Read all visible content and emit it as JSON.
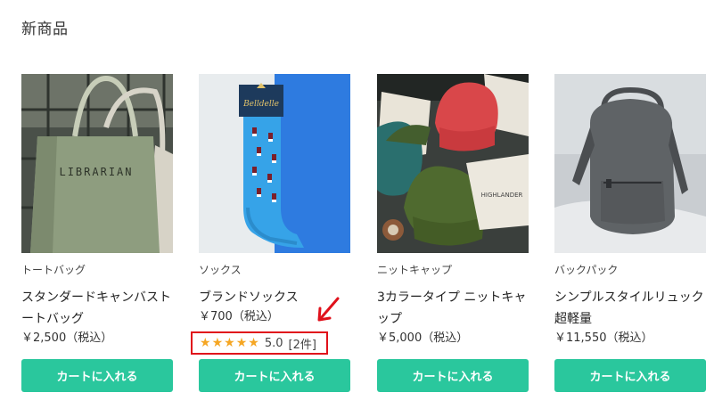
{
  "section": {
    "title": "新商品"
  },
  "products": [
    {
      "category": "トートバッグ",
      "name": "スタンダードキャンバストートバッグ",
      "price": "￥2,500（税込）",
      "cart_label": "カートに入れる",
      "image_text": "LIBRARIAN"
    },
    {
      "category": "ソックス",
      "name": "ブランドソックス",
      "price": "￥700（税込）",
      "cart_label": "カートに入れる",
      "image_text": "Belldelle",
      "rating": {
        "score": "5.0",
        "count": "[2件]",
        "stars": 5
      }
    },
    {
      "category": "ニットキャップ",
      "name": "3カラータイプ ニットキャップ",
      "price": "￥5,000（税込）",
      "cart_label": "カートに入れる",
      "image_text": "HIGHLANDER"
    },
    {
      "category": "バックパック",
      "name": "シンプルスタイルリュック超軽量",
      "price": "￥11,550（税込）",
      "cart_label": "カートに入れる"
    }
  ],
  "colors": {
    "button": "#2ac79d",
    "star": "#f5a623",
    "highlight": "#e0111b"
  }
}
